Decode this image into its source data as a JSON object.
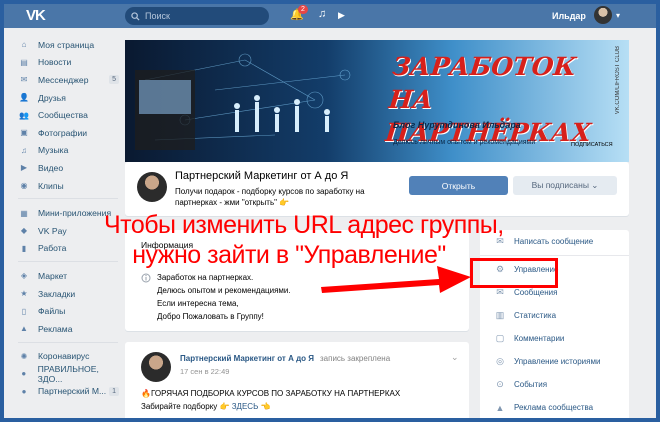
{
  "topbar": {
    "logo": "VK",
    "search_placeholder": "Поиск",
    "notifications_count": "2",
    "user_name": "Ильдар"
  },
  "sidebar": {
    "items": [
      {
        "label": "Моя страница",
        "icon": "home-icon"
      },
      {
        "label": "Новости",
        "icon": "news-icon"
      },
      {
        "label": "Мессенджер",
        "icon": "messenger-icon",
        "count": "5"
      },
      {
        "label": "Друзья",
        "icon": "friends-icon"
      },
      {
        "label": "Сообщества",
        "icon": "communities-icon"
      },
      {
        "label": "Фотографии",
        "icon": "photos-icon"
      },
      {
        "label": "Музыка",
        "icon": "music-icon"
      },
      {
        "label": "Видео",
        "icon": "video-icon"
      },
      {
        "label": "Клипы",
        "icon": "clips-icon"
      },
      {
        "label": "Мини-приложения",
        "icon": "apps-icon"
      },
      {
        "label": "VK Pay",
        "icon": "vkpay-icon"
      },
      {
        "label": "Работа",
        "icon": "work-icon"
      },
      {
        "label": "Маркет",
        "icon": "market-icon"
      },
      {
        "label": "Закладки",
        "icon": "bookmarks-icon"
      },
      {
        "label": "Файлы",
        "icon": "files-icon"
      },
      {
        "label": "Реклама",
        "icon": "ads-icon"
      },
      {
        "label": "Коронавирус",
        "icon": "coronavirus-icon"
      },
      {
        "label": "ПРАВИЛЬНОЕ, ЗДО...",
        "icon": "group-icon"
      },
      {
        "label": "Партнерский М...",
        "icon": "group-icon",
        "count": "1"
      }
    ]
  },
  "cover": {
    "title_line1": "ЗАРАБОТОК",
    "title_line2": "НА ПАРТНЁРКАХ",
    "blog": "Блог Нурутдинова Ильдара",
    "share": "Делюсь личным опытом и рекомендациями",
    "subscribe": "ПОДПИСАТЬСЯ",
    "club": "VK.COM/LIFROST CLUB"
  },
  "group": {
    "name": "Партнерский Маркетинг от А до Я",
    "status": "Получи подарок - подборку курсов по заработку на партнерках - жми \"открыть\" 👉",
    "open_button": "Открыть",
    "subscribed_button": "Вы подписаны ⌄"
  },
  "info": {
    "header": "Информация",
    "lines": [
      "Заработок на партнерках.",
      "Делюсь опытом и рекомендациями.",
      "Если интересна тема,",
      "Добро Пожаловать в Группу!"
    ]
  },
  "right_menu": {
    "items": [
      {
        "label": "Написать сообщение",
        "icon": "message-icon"
      },
      {
        "label": "Управление",
        "icon": "gear-icon"
      },
      {
        "label": "Сообщения",
        "icon": "chat-icon"
      },
      {
        "label": "Статистика",
        "icon": "stats-icon"
      },
      {
        "label": "Комментарии",
        "icon": "comments-icon"
      },
      {
        "label": "Управление историями",
        "icon": "stories-icon"
      },
      {
        "label": "События",
        "icon": "events-icon"
      },
      {
        "label": "Реклама сообщества",
        "icon": "ads-icon"
      }
    ]
  },
  "post": {
    "author": "Партнерский Маркетинг от А до Я",
    "pinned": "запись закреплена",
    "date": "17 сен в 22:49",
    "line1": "🔥ГОРЯЧАЯ ПОДБОРКА КУРСОВ ПО ЗАРАБОТКУ НА ПАРТНЕРКАХ",
    "line2_prefix": "Забирайте подборку 👉 ",
    "line2_link": "ЗДЕСЬ",
    "line2_suffix": " 👈"
  },
  "overlay": {
    "line1": "Чтобы изменить URL адрес группы,",
    "line2": "нужно зайти в \"Управление\""
  },
  "colors": {
    "header": "#4a76a8",
    "button": "#5181b8",
    "annotation": "#ff0000"
  }
}
